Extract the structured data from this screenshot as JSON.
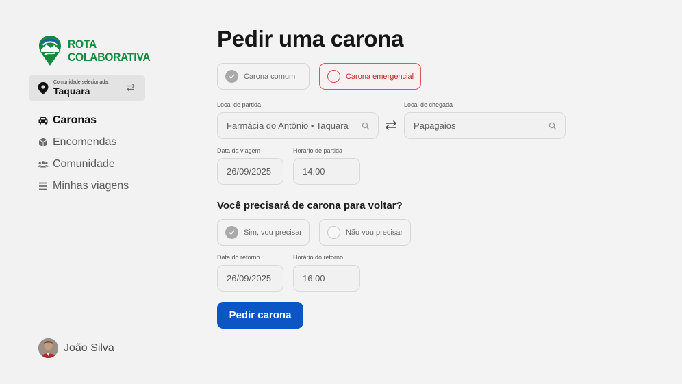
{
  "brand": {
    "line1": "ROTA",
    "line2": "COLABORATIVA",
    "color": "#138a3e"
  },
  "community": {
    "label": "Comunidade selecionada:",
    "name": "Taquara"
  },
  "nav": [
    {
      "label": "Caronas",
      "icon": "car-icon",
      "active": true
    },
    {
      "label": "Encomendas",
      "icon": "package-icon",
      "active": false
    },
    {
      "label": "Comunidade",
      "icon": "users-icon",
      "active": false
    },
    {
      "label": "Minhas viagens",
      "icon": "list-icon",
      "active": false
    }
  ],
  "user": {
    "name": "João Silva"
  },
  "page": {
    "title": "Pedir uma carona"
  },
  "ride_type": {
    "common": "Carona comum",
    "emergency": "Carona emergencial",
    "emergency_color": "#c4262c"
  },
  "departure": {
    "label": "Local de partida",
    "value": "Farmácia do Antônio • Taquara"
  },
  "arrival": {
    "label": "Local de chegada",
    "value": "Papagaios"
  },
  "trip_date": {
    "label": "Data da viagem",
    "value": "26/09/2025"
  },
  "trip_time": {
    "label": "Horário de partida",
    "value": "14:00"
  },
  "return_question": "Você precisará de carona para voltar?",
  "return_options": {
    "yes": "Sim, vou precisar",
    "no": "Não vou precisar"
  },
  "return_date": {
    "label": "Data do retorno",
    "value": "26/09/2025"
  },
  "return_time": {
    "label": "Horário do retorno",
    "value": "16:00"
  },
  "submit": {
    "label": "Pedir carona",
    "color": "#0b56c4"
  }
}
